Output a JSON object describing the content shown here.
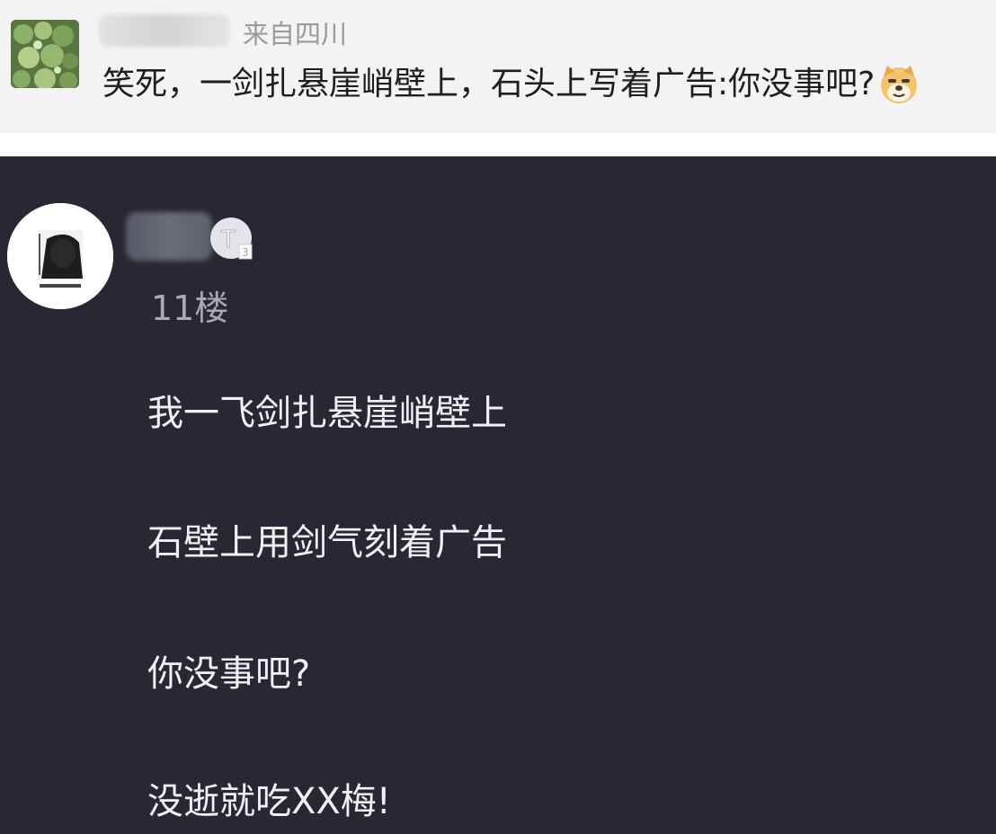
{
  "top_comment": {
    "location": "来自四川",
    "text": "笑死，一剑扎悬崖峭壁上，石头上写着广告:你没事吧?",
    "emoji_icon": "doge-face-icon"
  },
  "post": {
    "floor": "11楼",
    "badge_icon": "user-level-badge-icon",
    "lines": [
      "我一飞剑扎悬崖峭壁上",
      "石壁上用剑气刻着广告",
      "你没事吧?",
      "没逝就吃XX梅!"
    ]
  },
  "colors": {
    "top_background": "#f3f3f4",
    "dark_background": "#272833",
    "post_text": "#f1f1f4",
    "muted_text": "#a9abb4"
  }
}
